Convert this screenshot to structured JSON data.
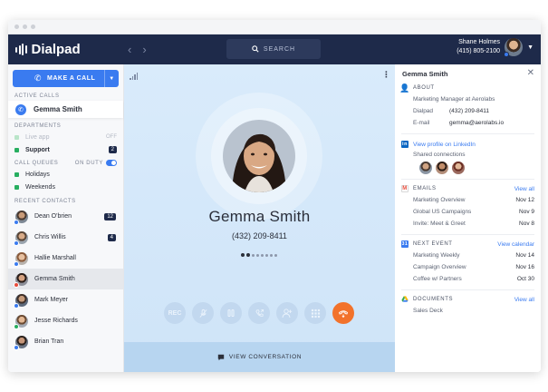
{
  "app": {
    "name": "Dialpad"
  },
  "header": {
    "search_label": "SEARCH",
    "user_name": "Shane Holmes",
    "user_phone": "(415) 805-2100"
  },
  "sidebar": {
    "make_call_label": "MAKE A CALL",
    "active_calls_label": "ACTIVE CALLS",
    "active_call_name": "Gemma Smith",
    "departments_label": "DEPARTMENTS",
    "departments": [
      {
        "label": "Live app",
        "status": "OFF"
      },
      {
        "label": "Support",
        "count": "2"
      }
    ],
    "call_queues_label": "CALL QUEUES",
    "on_duty_label": "ON DUTY",
    "queues": [
      {
        "label": "Holidays"
      },
      {
        "label": "Weekends"
      }
    ],
    "recent_contacts_label": "RECENT CONTACTS",
    "contacts": [
      {
        "name": "Dean O'brien",
        "count": "12"
      },
      {
        "name": "Chris Willis",
        "count": "4"
      },
      {
        "name": "Hallie Marshall"
      },
      {
        "name": "Gemma Smith"
      },
      {
        "name": "Mark Meyer"
      },
      {
        "name": "Jesse Richards"
      },
      {
        "name": "Brian Tran"
      }
    ]
  },
  "call": {
    "name": "Gemma Smith",
    "phone": "(432) 209-8411",
    "rec_label": "REC",
    "view_conversation_label": "VIEW CONVERSATION"
  },
  "panel": {
    "title": "Gemma Smith",
    "about_label": "ABOUT",
    "about_title": "Marketing Manager at Aerolabs",
    "dialpad_key": "Dialpad",
    "dialpad_value": "(432) 209-8411",
    "email_key": "E-mail",
    "email_value": "gemma@aerolabs.io",
    "linkedin_label": "View profile on LinkedIn",
    "shared_connections_label": "Shared connections",
    "emails_label": "EMAILS",
    "emails_view_all": "View all",
    "emails": [
      {
        "subject": "Marketing Overview",
        "date": "Nov 12"
      },
      {
        "subject": "Global US Campaigns",
        "date": "Nov 9"
      },
      {
        "subject": "Invite: Meet & Greet",
        "date": "Nov 8"
      }
    ],
    "next_event_label": "NEXT EVENT",
    "view_calendar_label": "View calendar",
    "events": [
      {
        "subject": "Marketing Weekly",
        "date": "Nov 14"
      },
      {
        "subject": "Campaign Overview",
        "date": "Nov 16"
      },
      {
        "subject": "Coffee w/ Partners",
        "date": "Oct 30"
      }
    ],
    "documents_label": "DOCUMENTS",
    "documents_view_all": "View all",
    "documents": [
      {
        "name": "Sales Deck"
      }
    ]
  },
  "colors": {
    "accent": "#3a7bf0",
    "topbar": "#1e2a4a",
    "end_call": "#f2722b",
    "online": "#27ae60"
  }
}
